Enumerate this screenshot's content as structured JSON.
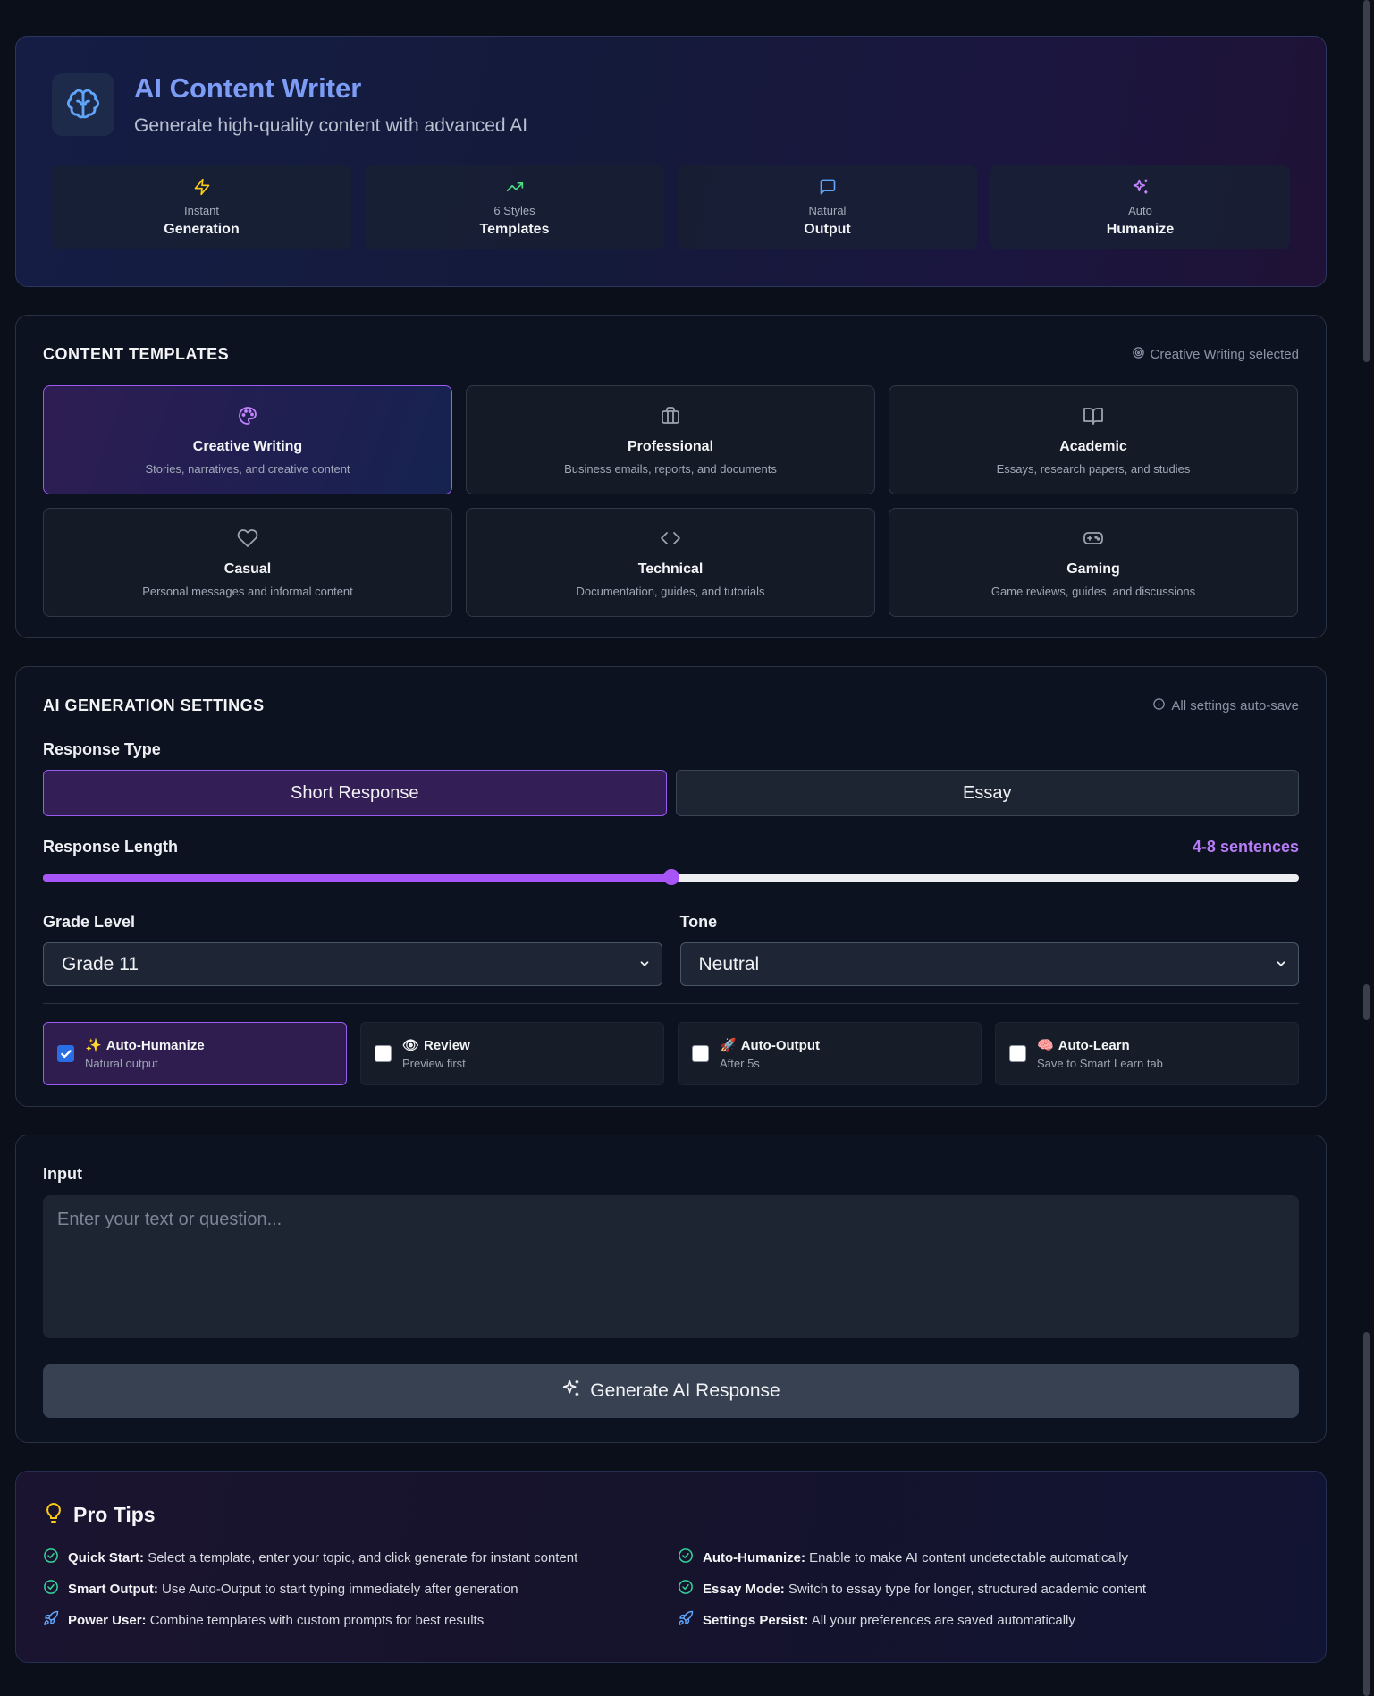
{
  "header": {
    "title": "AI Content Writer",
    "subtitle": "Generate high-quality content with advanced AI",
    "stats": [
      {
        "small": "Instant",
        "big": "Generation",
        "icon": "zap-icon",
        "color": "#facc15"
      },
      {
        "small": "6 Styles",
        "big": "Templates",
        "icon": "trending-up-icon",
        "color": "#4ade80"
      },
      {
        "small": "Natural",
        "big": "Output",
        "icon": "message-square-icon",
        "color": "#60a5fa"
      },
      {
        "small": "Auto",
        "big": "Humanize",
        "icon": "sparkles-icon",
        "color": "#c084fc"
      }
    ]
  },
  "templates": {
    "title": "CONTENT TEMPLATES",
    "hint": "Creative Writing selected",
    "items": [
      {
        "name": "Creative Writing",
        "desc": "Stories, narratives, and creative content",
        "icon": "palette-icon",
        "active": true
      },
      {
        "name": "Professional",
        "desc": "Business emails, reports, and documents",
        "icon": "briefcase-icon"
      },
      {
        "name": "Academic",
        "desc": "Essays, research papers, and studies",
        "icon": "book-open-icon"
      },
      {
        "name": "Casual",
        "desc": "Personal messages and informal content",
        "icon": "heart-icon"
      },
      {
        "name": "Technical",
        "desc": "Documentation, guides, and tutorials",
        "icon": "code-icon"
      },
      {
        "name": "Gaming",
        "desc": "Game reviews, guides, and discussions",
        "icon": "gamepad-icon"
      }
    ]
  },
  "settings": {
    "title": "AI GENERATION SETTINGS",
    "hint": "All settings auto-save",
    "response_type_label": "Response Type",
    "response_types": [
      "Short Response",
      "Essay"
    ],
    "response_length_label": "Response Length",
    "response_length_value": "4-8 sentences",
    "response_length_fraction": 0.5,
    "grade_label": "Grade Level",
    "grade_value": "Grade 11",
    "tone_label": "Tone",
    "tone_value": "Neutral",
    "options": [
      {
        "emoji": "✨",
        "title": "Auto-Humanize",
        "sub": "Natural output",
        "checked": true
      },
      {
        "emoji": "👁",
        "title": "Review",
        "sub": "Preview first",
        "checked": false
      },
      {
        "emoji": "🚀",
        "title": "Auto-Output",
        "sub": "After 5s",
        "checked": false
      },
      {
        "emoji": "🧠",
        "title": "Auto-Learn",
        "sub": "Save to Smart Learn tab",
        "checked": false
      }
    ]
  },
  "input": {
    "label": "Input",
    "placeholder": "Enter your text or question...",
    "button": "Generate AI Response"
  },
  "tips": {
    "title": "Pro Tips",
    "items": [
      {
        "bold": "Quick Start:",
        "text": " Select a template, enter your topic, and click generate for instant content",
        "icon": "check-circle-icon"
      },
      {
        "bold": "Auto-Humanize:",
        "text": " Enable to make AI content undetectable automatically",
        "icon": "check-circle-icon"
      },
      {
        "bold": "Smart Output:",
        "text": " Use Auto-Output to start typing immediately after generation",
        "icon": "check-circle-icon"
      },
      {
        "bold": "Essay Mode:",
        "text": " Switch to essay type for longer, structured academic content",
        "icon": "check-circle-icon"
      },
      {
        "bold": "Power User:",
        "text": " Combine templates with custom prompts for best results",
        "icon": "rocket-icon"
      },
      {
        "bold": "Settings Persist:",
        "text": " All your preferences are saved automatically",
        "icon": "rocket-icon"
      }
    ]
  }
}
